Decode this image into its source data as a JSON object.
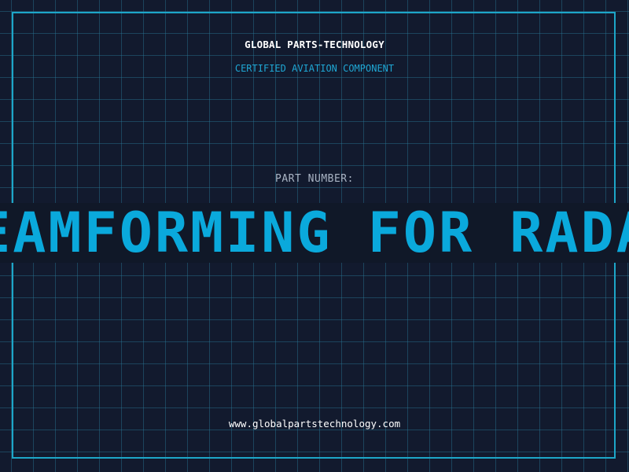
{
  "header": {
    "company": "GLOBAL PARTS-TECHNOLOGY",
    "tagline": "CERTIFIED AVIATION COMPONENT"
  },
  "part": {
    "label": "PART NUMBER:",
    "value": "BEAMFORMING FOR RADAR"
  },
  "footer": {
    "website": "www.globalpartstechnology.com"
  },
  "colors": {
    "background": "#121a2e",
    "grid": "#287896",
    "frame": "#1da6c8",
    "accent": "#0aa9dc"
  }
}
